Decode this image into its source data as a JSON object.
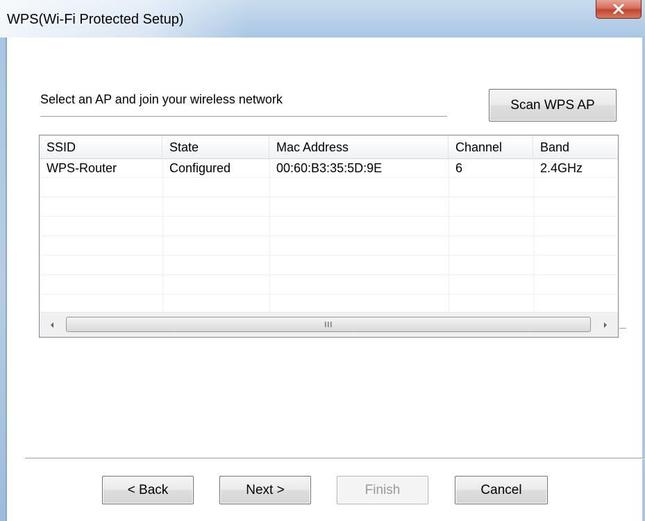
{
  "window": {
    "title": "WPS(Wi-Fi Protected Setup)",
    "close_icon": "close-x-icon"
  },
  "main": {
    "prompt": "Select an AP and join your wireless network",
    "scan_button": "Scan WPS AP"
  },
  "ap_list": {
    "columns": [
      "SSID",
      "State",
      "Mac Address",
      "Channel",
      "Band"
    ],
    "rows": [
      {
        "ssid": "WPS-Router",
        "state": "Configured",
        "mac": "00:60:B3:35:5D:9E",
        "channel": "6",
        "band": "2.4GHz"
      }
    ],
    "scrollbar": {
      "left_icon": "scroll-left-arrow-icon",
      "right_icon": "scroll-right-arrow-icon",
      "grip_icon": "scroll-grip-icon"
    }
  },
  "footer": {
    "back": "< Back",
    "next": "Next >",
    "finish": "Finish",
    "cancel": "Cancel",
    "finish_enabled": false
  }
}
